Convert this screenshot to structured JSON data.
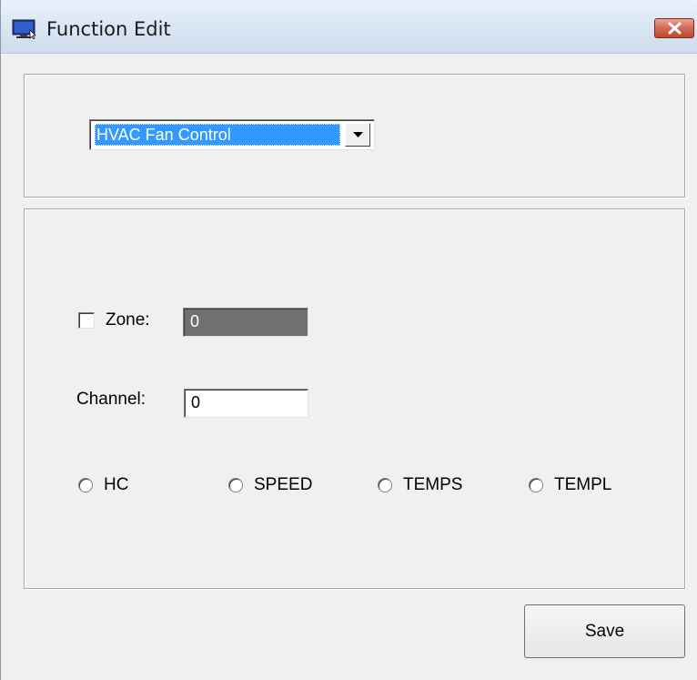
{
  "window": {
    "title": "Function Edit",
    "icon": "monitor-icon",
    "close_icon": "close-icon"
  },
  "function_select": {
    "selected_value": "HVAC Fan Control"
  },
  "zone": {
    "label": "Zone:",
    "checked": false,
    "value": "0",
    "enabled": false
  },
  "channel": {
    "label": "Channel:",
    "value": "0"
  },
  "radio_options": {
    "hc": "HC",
    "speed": "SPEED",
    "temps": "TEMPS",
    "templ": "TEMPL"
  },
  "buttons": {
    "save_label": "Save"
  },
  "colors": {
    "selection": "#3399ff",
    "disabled_field": "#707070",
    "close_button": "#c2462e"
  }
}
